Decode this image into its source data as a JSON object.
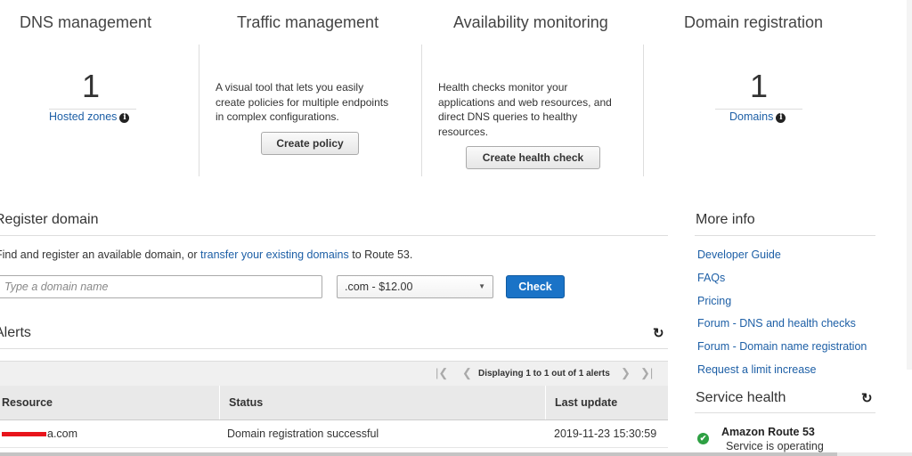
{
  "panels": {
    "dns": {
      "title": "DNS management",
      "count": "1",
      "link": "Hosted zones"
    },
    "traffic": {
      "title": "Traffic management",
      "desc_lines": [
        "A visual tool that lets you easily",
        "create policies for multiple endpoints",
        "in complex configurations."
      ],
      "button": "Create policy"
    },
    "availability": {
      "title": "Availability monitoring",
      "desc_lines": [
        "Health checks monitor your",
        "applications and web resources, and",
        "direct DNS queries to healthy",
        "resources."
      ],
      "button": "Create health check"
    },
    "domain": {
      "title": "Domain registration",
      "count": "1",
      "link": "Domains"
    }
  },
  "register": {
    "title": "Register domain",
    "intro_before": "Find and register an available domain, or",
    "intro_link": "transfer your existing domains",
    "intro_after": "to Route 53.",
    "input_placeholder": "Type a domain name",
    "tld_selected": ".com - $12.00",
    "check_button": "Check"
  },
  "alerts": {
    "title": "Alerts",
    "pager_text": "Displaying 1 to 1 out of 1 alerts",
    "columns": [
      "Resource",
      "Status",
      "Last update"
    ],
    "rows": [
      {
        "resource": "a.com",
        "status": "Domain registration successful",
        "last_update": "2019-11-23 15:30:59"
      }
    ]
  },
  "more_info": {
    "title": "More info",
    "links": [
      "Developer Guide",
      "FAQs",
      "Pricing",
      "Forum - DNS and health checks",
      "Forum - Domain name registration",
      "Request a limit increase"
    ]
  },
  "service_health": {
    "title": "Service health",
    "service_name": "Amazon Route 53",
    "service_status": "Service is operating"
  },
  "icons": {
    "info": "info-icon",
    "refresh": "refresh-icon",
    "check": "check-circle-icon",
    "first": "first-page-icon",
    "prev": "prev-page-icon",
    "next": "next-page-icon",
    "last": "last-page-icon"
  },
  "colors": {
    "link": "#1d5fa6",
    "primary": "#1a73c7",
    "healthy": "#2ea043",
    "redacted": "#e8141b"
  }
}
